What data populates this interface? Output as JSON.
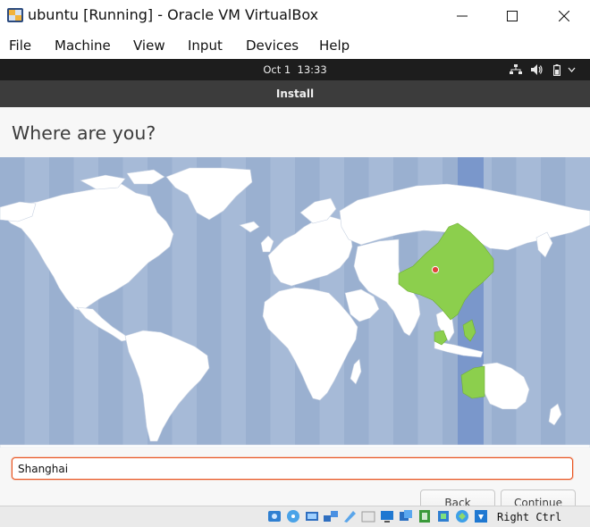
{
  "window": {
    "title": "ubuntu [Running] - Oracle VM VirtualBox",
    "icons": [
      "virtualbox-app-icon",
      "minimize-icon",
      "maximize-icon",
      "close-icon"
    ]
  },
  "menu": {
    "items": [
      "File",
      "Machine",
      "View",
      "Input",
      "Devices",
      "Help"
    ]
  },
  "guest_topbar": {
    "date": "Oct 1",
    "time": "13:33",
    "icons": [
      "network-icon",
      "volume-icon",
      "battery-icon",
      "chevron-down-icon"
    ]
  },
  "installer": {
    "header_title": "Install",
    "page_title": "Where are you?",
    "map": {
      "highlight_color": "#8ccf4d",
      "water_color": "#9ab0d0",
      "selected_zone_color": "#7a97cb",
      "land_color": "#ffffff",
      "pin_color": "#e0463b"
    },
    "location": {
      "value": "Shanghai"
    },
    "buttons": {
      "back": "Back",
      "continue": "Continue"
    },
    "accent_color": "#e95420"
  },
  "statusbar": {
    "host_key": "Right Ctrl",
    "icons": [
      "hard-disk-icon",
      "optical-drive-icon",
      "audio-icon",
      "network-adapter-icon",
      "usb-icon",
      "shared-folders-icon",
      "display-icon",
      "video-capture-icon",
      "recording-icon",
      "cpu-icon",
      "mouse-integration-icon",
      "keyboard-arrow-icon"
    ]
  }
}
